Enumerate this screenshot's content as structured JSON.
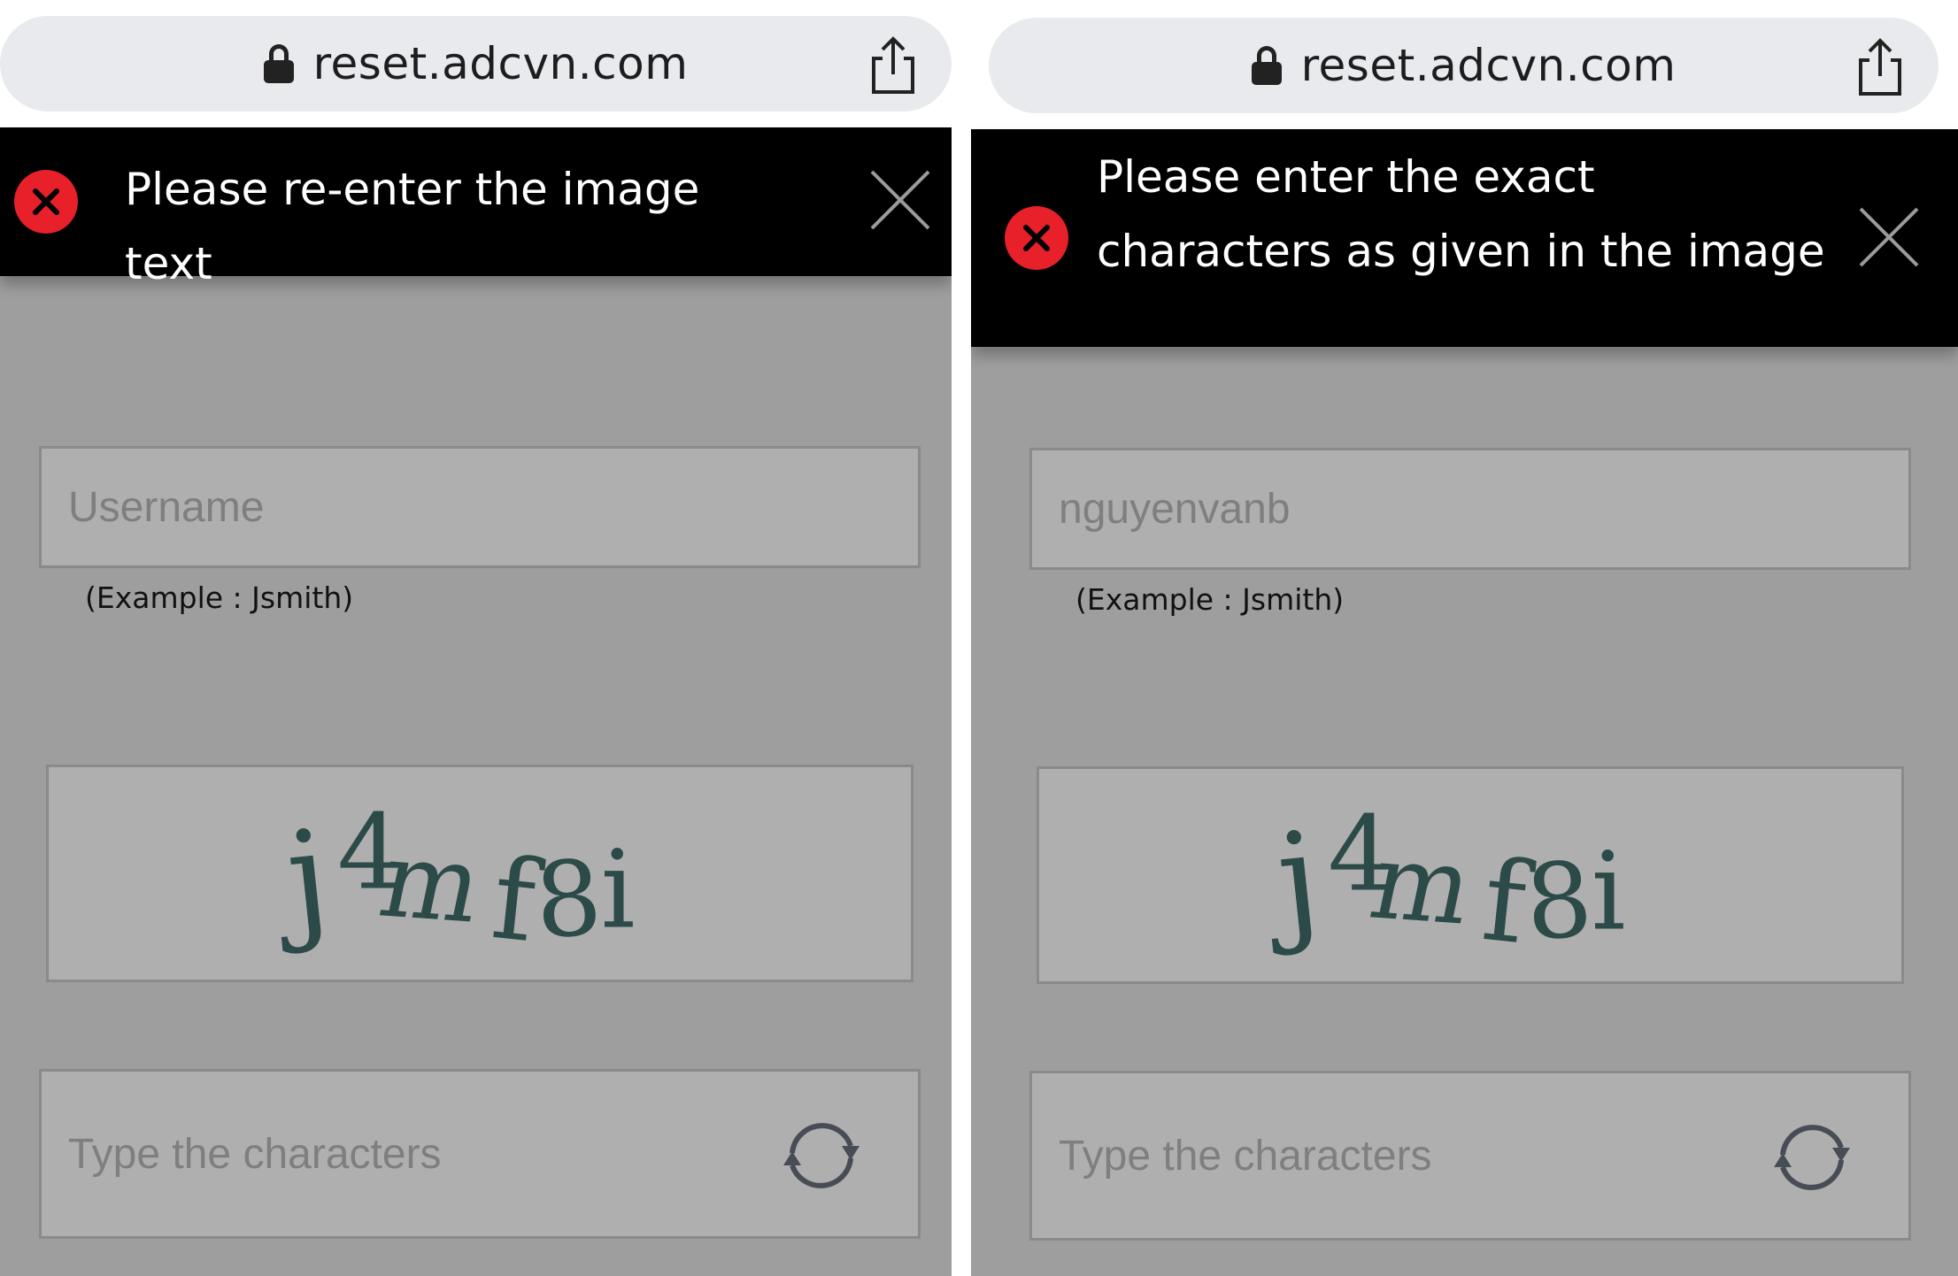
{
  "panels": [
    {
      "url": "reset.adcvn.com",
      "error_message": "Please re-enter the image text",
      "username": {
        "placeholder": "Username",
        "value": ""
      },
      "hint": "(Example : Jsmith)",
      "captcha_text": "j4mf8i",
      "characters": {
        "placeholder": "Type the characters"
      },
      "icons": [
        "lock-icon",
        "share-icon",
        "error-icon",
        "close-icon",
        "refresh-icon"
      ]
    },
    {
      "url": "reset.adcvn.com",
      "error_message": "Please enter the exact characters as given in the image",
      "username": {
        "placeholder": "",
        "value": "nguyenvanb"
      },
      "hint": "(Example : Jsmith)",
      "captcha_text": "j4mf8i",
      "characters": {
        "placeholder": "Type the characters"
      },
      "icons": [
        "lock-icon",
        "share-icon",
        "error-icon",
        "close-icon",
        "refresh-icon"
      ]
    }
  ],
  "colors": {
    "error_red": "#e7202a",
    "banner_black": "#000000",
    "overlay_gray": "#9d9e9d",
    "field_gray": "#afafaf",
    "captcha_ink": "#2c4a48"
  }
}
